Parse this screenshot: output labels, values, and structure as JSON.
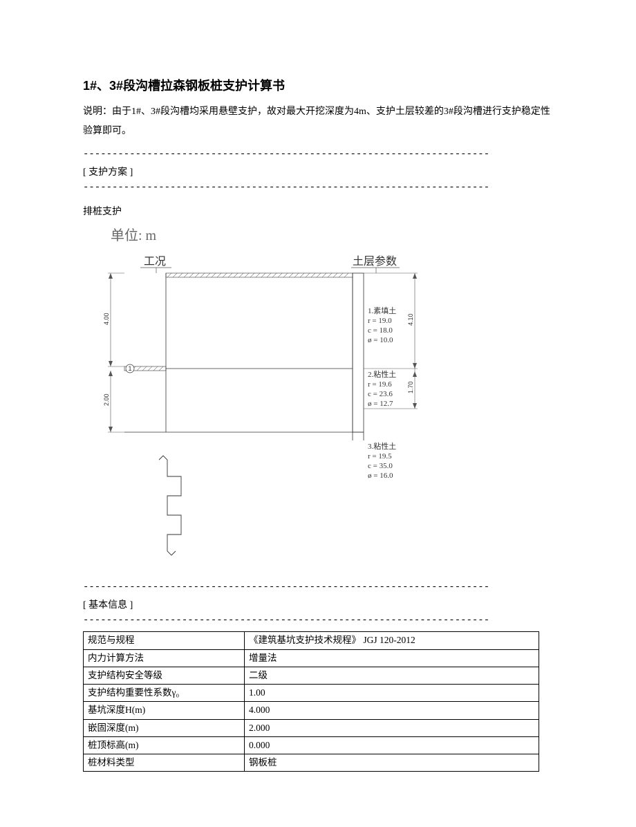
{
  "title": "1#、3#段沟槽拉森钢板桩支护计算书",
  "description": "说明：由于1#、3#段沟槽均采用悬壁支护，故对最大开挖深度为4m、支护土层较差的3#段沟槽进行支护稳定性验算即可。",
  "dash_line": "----------------------------------------------------------------------",
  "section1_title": "[ 支护方案 ]",
  "pile_support": "排桩支护",
  "diagram": {
    "unit_label": "单位:  m",
    "left_top": "工况",
    "right_top": "土层参数",
    "dim_left_upper": "4.00",
    "dim_left_lower": "2.00",
    "dim_right_upper": "4.10",
    "dim_right_lower": "1.70",
    "circle_num": "1",
    "layer1": {
      "name": "1.素填土",
      "r": "r  =  19.0",
      "c": "c  =  18.0",
      "phi": "ø  =  10.0"
    },
    "layer2": {
      "name": "2.粘性土",
      "r": "r  =  19.6",
      "c": "c  =  23.6",
      "phi": "ø  =  12.7"
    },
    "layer3": {
      "name": "3.粘性土",
      "r": "r  =  19.5",
      "c": "c  =  35.0",
      "phi": "ø  =  16.0"
    }
  },
  "section2_title": "[ 基本信息 ]",
  "info_table": [
    {
      "label": "规范与规程",
      "value": "《建筑基坑支护技术规程》 JGJ 120-2012"
    },
    {
      "label": "内力计算方法",
      "value": "增量法"
    },
    {
      "label": "支护结构安全等级",
      "value": "二级"
    },
    {
      "label": "支护结构重要性系数γ₀",
      "value": "1.00"
    },
    {
      "label": "基坑深度H(m)",
      "value": "4.000"
    },
    {
      "label": "嵌固深度(m)",
      "value": "2.000"
    },
    {
      "label": "桩顶标高(m)",
      "value": "0.000"
    },
    {
      "label": "桩材料类型",
      "value": "钢板桩"
    }
  ]
}
